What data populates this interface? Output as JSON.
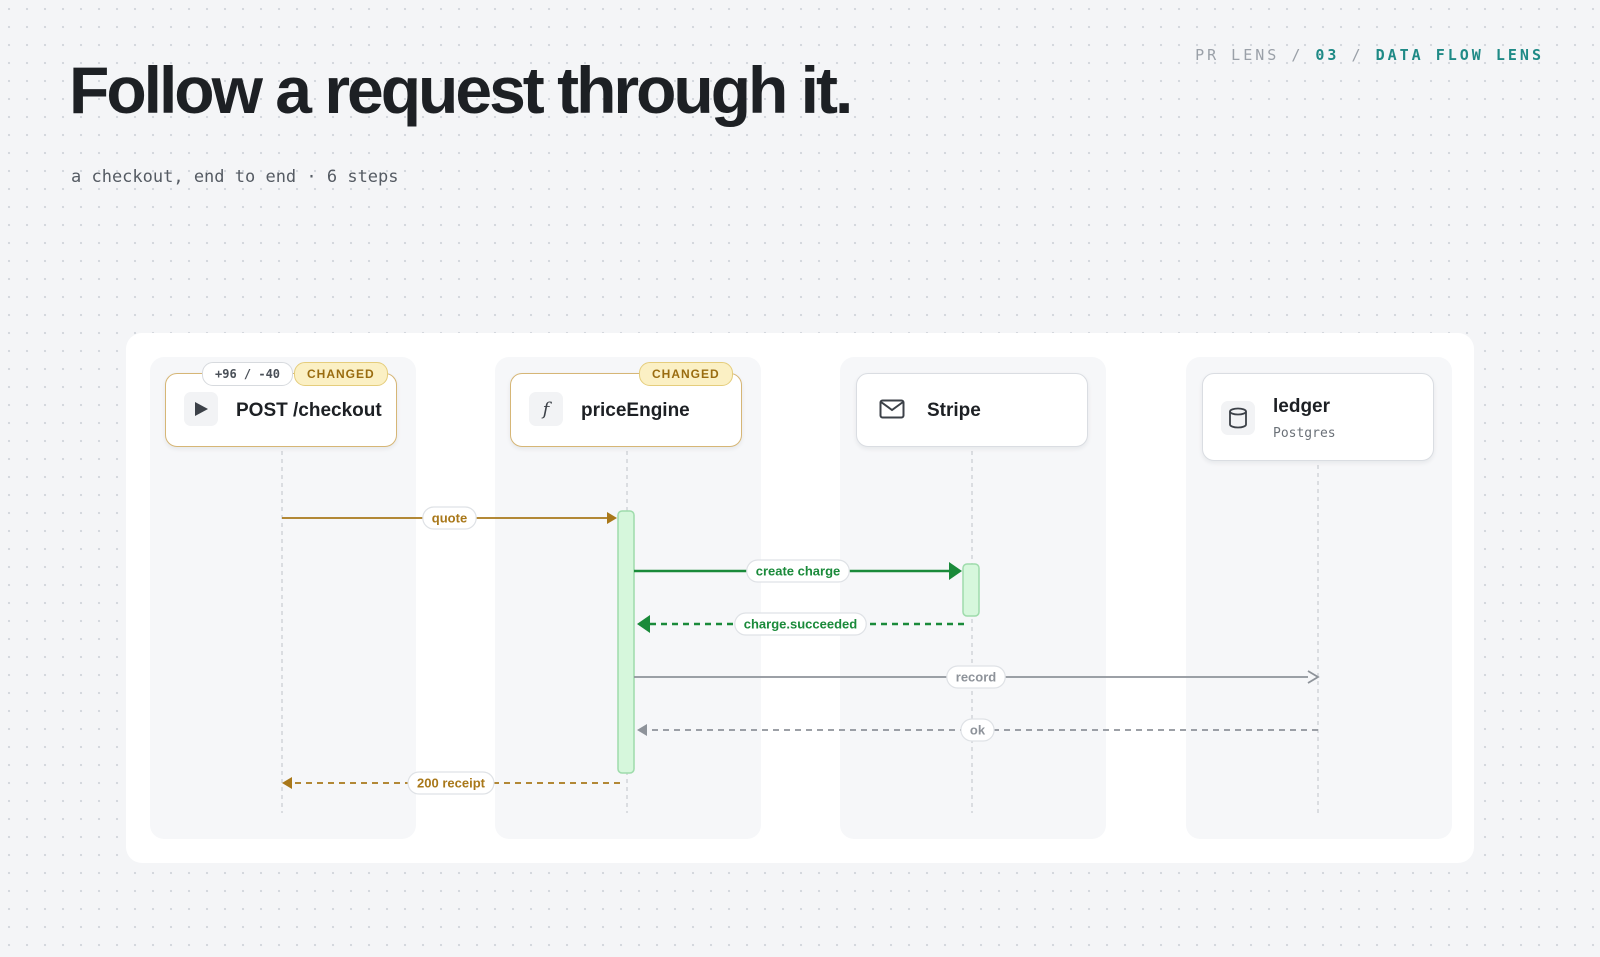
{
  "header": {
    "breadcrumb": {
      "part1": "PR LENS",
      "sep1": "/",
      "part2": "03",
      "sep2": "/",
      "part3": "DATA FLOW LENS"
    },
    "title": "Follow a request through it.",
    "subtitle": "a checkout, end to end · 6 steps"
  },
  "nodes": [
    {
      "id": "checkout",
      "label": "POST /checkout",
      "sublabel": "",
      "icon": "play-icon",
      "changed": true,
      "badge": "CHANGED",
      "diff": "+96 / -40"
    },
    {
      "id": "price",
      "label": "priceEngine",
      "sublabel": "",
      "icon": "function-icon",
      "changed": true,
      "badge": "CHANGED",
      "diff": ""
    },
    {
      "id": "stripe",
      "label": "Stripe",
      "sublabel": "",
      "icon": "envelope-icon",
      "changed": false,
      "badge": "",
      "diff": ""
    },
    {
      "id": "ledger",
      "label": "ledger",
      "sublabel": "Postgres",
      "icon": "database-icon",
      "changed": false,
      "badge": "",
      "diff": ""
    }
  ],
  "messages": [
    {
      "label": "quote",
      "from": 0,
      "to": 1,
      "style": "solid",
      "color": "#a9781a"
    },
    {
      "label": "create charge",
      "from": 1,
      "to": 2,
      "style": "solid",
      "color": "#1a8a3a"
    },
    {
      "label": "charge.succeeded",
      "from": 2,
      "to": 1,
      "style": "dashed",
      "color": "#1a8a3a"
    },
    {
      "label": "record",
      "from": 1,
      "to": 3,
      "style": "solid",
      "color": "#8e939a"
    },
    {
      "label": "ok",
      "from": 3,
      "to": 1,
      "style": "dashed",
      "color": "#8e939a"
    },
    {
      "label": "200 receipt",
      "from": 1,
      "to": 0,
      "style": "dashed",
      "color": "#a9781a"
    }
  ],
  "colors": {
    "accent": "#1f8a86",
    "changed_border": "#d6b676",
    "activation_fill": "#d6f7dc",
    "activation_stroke": "#9edcab"
  }
}
